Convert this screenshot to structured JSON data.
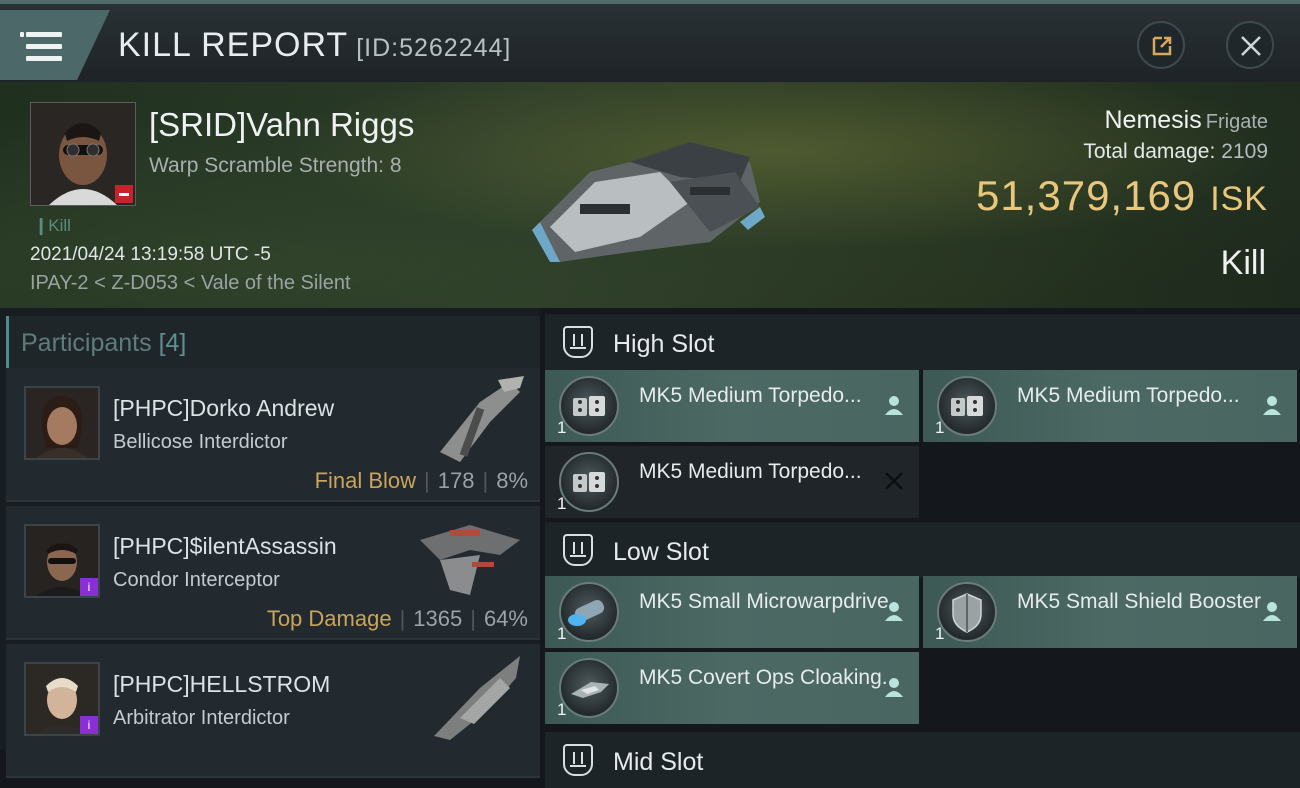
{
  "header": {
    "title": "KILL REPORT",
    "report_id": "[ID:5262244]",
    "icons": {
      "menu": "hamburger-icon",
      "share": "share-icon",
      "close": "close-icon"
    }
  },
  "victim": {
    "name": "[SRID]Vahn Riggs",
    "warp_scramble": "Warp Scramble Strength: 8",
    "kill_tag": "Kill",
    "datetime": "2021/04/24 13:19:58 UTC -5",
    "location": "IPAY-2 < Z-D053 < Vale of the Silent",
    "ship_name": "Nemesis",
    "ship_class": "Frigate",
    "total_damage_label": "Total damage:",
    "total_damage": "2109",
    "isk_value": "51,379,169",
    "isk_unit": "ISK",
    "result": "Kill"
  },
  "participants": {
    "label": "Participants",
    "count": "[4]",
    "items": [
      {
        "name": "[PHPC]Dorko Andrew",
        "ship": "Bellicose Interdictor",
        "tag": "Final Blow",
        "damage": "178",
        "percent": "8%"
      },
      {
        "name": "[PHPC]$ilentAssassin",
        "ship": "Condor Interceptor",
        "tag": "Top Damage",
        "damage": "1365",
        "percent": "64%"
      },
      {
        "name": "[PHPC]HELLSTROM",
        "ship": "Arbitrator Interdictor",
        "tag": "",
        "damage": "",
        "percent": ""
      }
    ]
  },
  "slots": {
    "high": {
      "title": "High Slot",
      "modules": [
        {
          "name": "MK5 Medium Torpedo...",
          "qty": "1",
          "status": "dropped"
        },
        {
          "name": "MK5 Medium Torpedo...",
          "qty": "1",
          "status": "dropped"
        },
        {
          "name": "MK5 Medium Torpedo...",
          "qty": "1",
          "status": "destroyed"
        }
      ]
    },
    "low": {
      "title": "Low Slot",
      "modules": [
        {
          "name": "MK5 Small Microwarpdrive",
          "qty": "1",
          "status": "dropped"
        },
        {
          "name": "MK5 Small Shield Booster",
          "qty": "1",
          "status": "dropped"
        },
        {
          "name": "MK5 Covert Ops Cloaking...",
          "qty": "1",
          "status": "dropped"
        }
      ]
    },
    "mid": {
      "title": "Mid Slot"
    }
  },
  "colors": {
    "accent_teal": "#4e8d8b",
    "isk_gold": "#e8c77c",
    "tag_gold": "#c9a45a",
    "module_tile": "#4c6964",
    "badge_purple": "#8a2fd4"
  }
}
